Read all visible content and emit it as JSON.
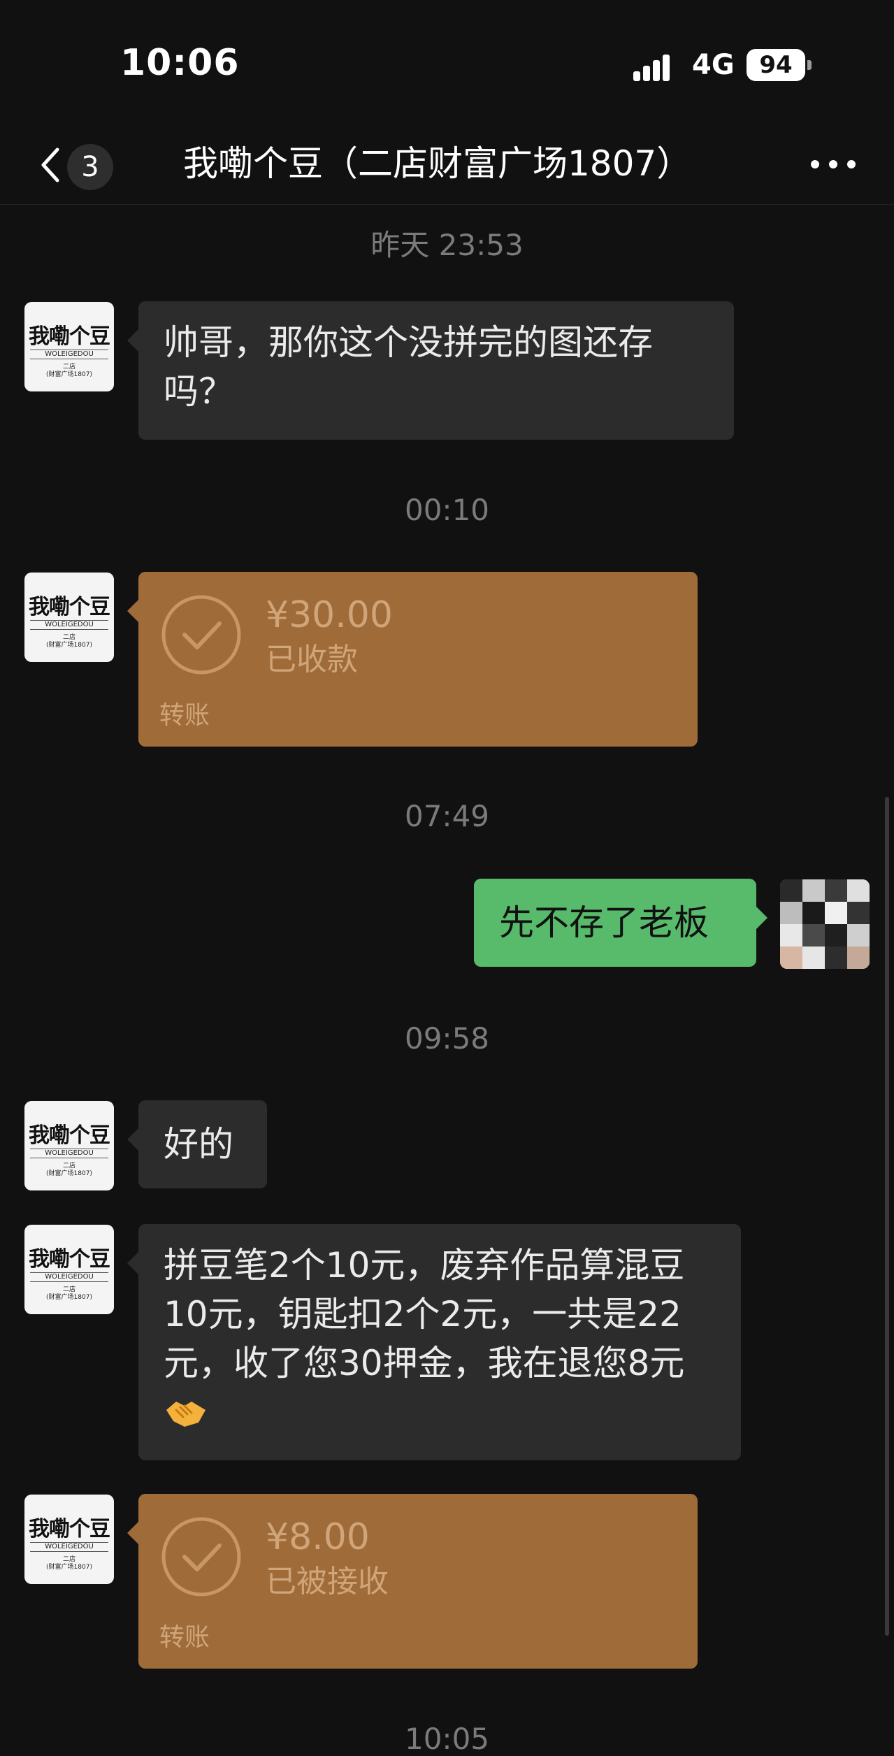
{
  "status_bar": {
    "time": "10:06",
    "network": "4G",
    "battery": "94"
  },
  "header": {
    "unread_count": "3",
    "title": "我嘞个豆（二店财富广场1807）"
  },
  "avatar_logo": {
    "main": "我嘞个豆",
    "sub": "WOLEIGEDOU",
    "store_line1": "二店",
    "store_line2": "(财富广场1807)"
  },
  "messages": {
    "ts1": "昨天 23:53",
    "msg1": "帅哥，那你这个没拼完的图还存吗？",
    "ts2": "00:10",
    "transfer1": {
      "amount": "¥30.00",
      "status": "已收款",
      "label": "转账"
    },
    "ts3": "07:49",
    "msg2": "先不存了老板",
    "ts4": "09:58",
    "msg3": "好的",
    "msg4": "拼豆笔2个10元，废弃作品算混豆10元，钥匙扣2个2元，一共是22元，收了您30押金，我在退您8元",
    "transfer2": {
      "amount": "¥8.00",
      "status": "已被接收",
      "label": "转账"
    },
    "ts5": "10:05"
  },
  "icons": {
    "back": "chevron-left-icon",
    "more": "more-dots-icon",
    "check": "check-circle-icon",
    "emoji": "handshake-emoji"
  },
  "colors": {
    "background": "#111111",
    "bubble_in": "#2c2c2c",
    "bubble_out": "#57bb6b",
    "transfer": "#9f6b39"
  }
}
